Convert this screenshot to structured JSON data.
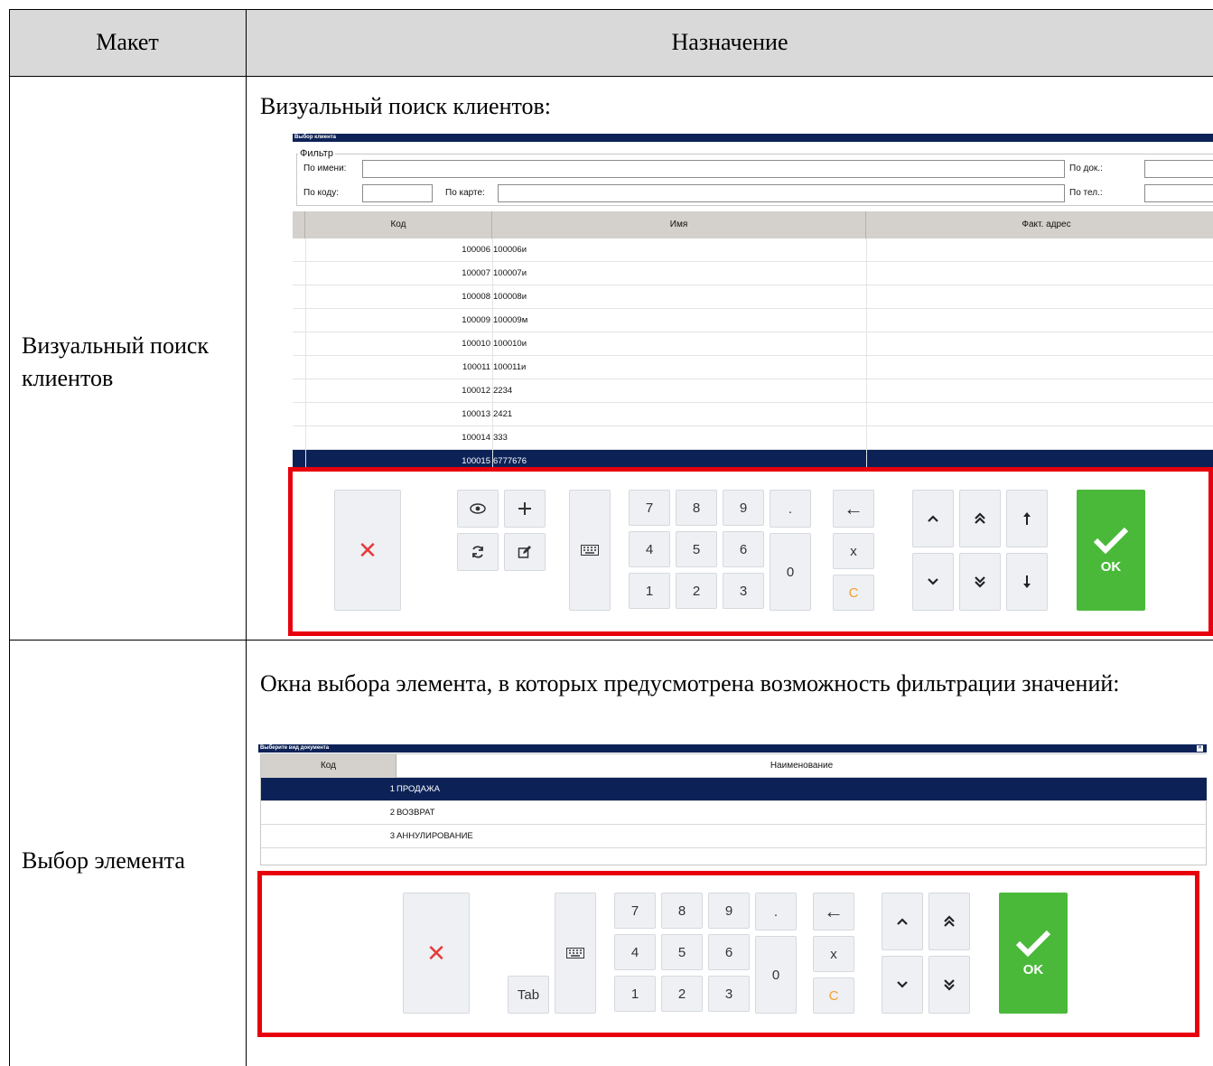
{
  "table": {
    "header": {
      "col1": "Макет",
      "col2": "Назначение"
    },
    "rows": [
      {
        "label": "Визуальный поиск клиентов",
        "description": "Визуальный поиск клиентов:"
      },
      {
        "label": "Выбор элемента",
        "description": "Окна выбора элемента, в которых предусмотрена возможность фильтрации значений:"
      }
    ]
  },
  "client_window": {
    "title": "Выбор клиента",
    "filter_legend": "Фильтр",
    "by_name": "По имени:",
    "by_doc": "По док.:",
    "by_code": "По коду:",
    "by_card": "По карте:",
    "by_phone": "По тел.:",
    "columns": [
      "Код",
      "Имя",
      "Факт. адрес"
    ],
    "rows": [
      {
        "code": "100006",
        "name": "100006и"
      },
      {
        "code": "100007",
        "name": "100007и"
      },
      {
        "code": "100008",
        "name": "100008и"
      },
      {
        "code": "100009",
        "name": "100009м"
      },
      {
        "code": "100010",
        "name": "100010и"
      },
      {
        "code": "100011",
        "name": "100011и"
      },
      {
        "code": "100012",
        "name": "2234"
      },
      {
        "code": "100013",
        "name": "2421"
      },
      {
        "code": "100014",
        "name": "333"
      },
      {
        "code": "100015",
        "name": "6777676"
      }
    ],
    "selected_row_index": 9
  },
  "doc_window": {
    "title": "Выберите вид документа",
    "columns": [
      "Код",
      "Наименование"
    ],
    "rows": [
      {
        "code": "1",
        "name": "ПРОДАЖА"
      },
      {
        "code": "2",
        "name": "ВОЗВРАТ"
      },
      {
        "code": "3",
        "name": "АННУЛИРОВАНИЕ"
      }
    ],
    "selected_row_index": 0
  },
  "keypad": {
    "digits": [
      "7",
      "8",
      "9",
      "4",
      "5",
      "6",
      "1",
      "2",
      "3"
    ],
    "zero": "0",
    "dot": ".",
    "x": "x",
    "clear": "C",
    "ok": "OK",
    "tab": "Tab",
    "close_glyph": "✕",
    "back_glyph": "←",
    "up_glyph": "⌃",
    "down_glyph": "⌄"
  },
  "colors": {
    "selection": "#0c2257",
    "ok_green": "#4ab93a",
    "highlight_frame": "#e8000d",
    "clear_orange": "#f0a030"
  },
  "icons": [
    "eye-icon",
    "plus-icon",
    "refresh-icon",
    "edit-icon",
    "keyboard-icon",
    "close-icon",
    "backspace-icon",
    "chevron-up-icon",
    "double-chevron-up-icon",
    "arrow-to-top-icon",
    "chevron-down-icon",
    "double-chevron-down-icon",
    "arrow-to-bottom-icon",
    "checkmark-icon"
  ]
}
